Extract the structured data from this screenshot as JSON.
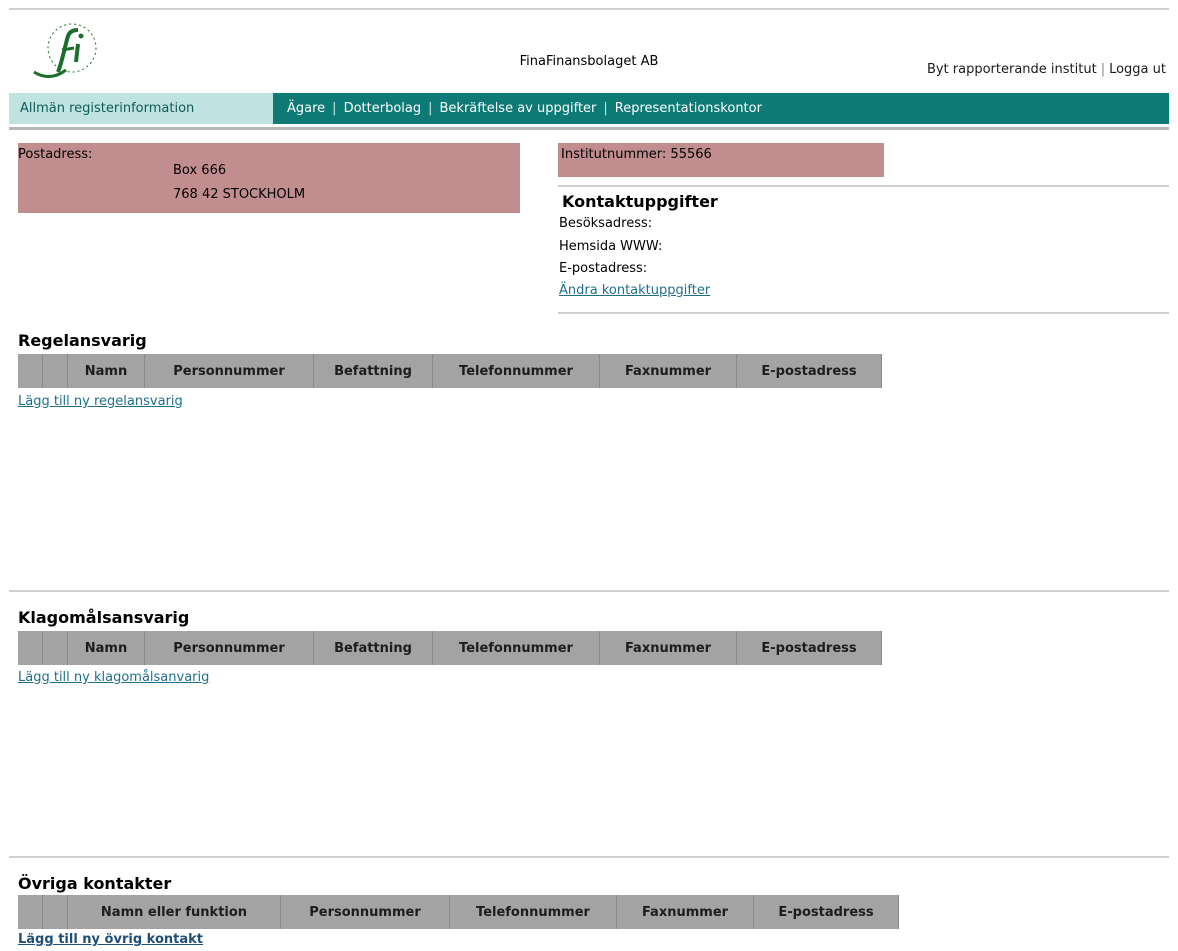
{
  "header": {
    "company_name": "FinaFinansbolaget AB",
    "change_institute_link": "Byt rapporterande institut",
    "separator": "|",
    "logout_link": "Logga ut"
  },
  "nav": {
    "active_tab": "Allmän registerinformation",
    "tabs": [
      "Ägare",
      "Dotterbolag",
      "Bekräftelse av uppgifter",
      "Representationskontor"
    ],
    "active_color": "#bfe3e1",
    "bar_color": "#0e7a76"
  },
  "postal": {
    "label": "Postadress:",
    "line1": "Box 666",
    "line2": "768 42 STOCKHOLM",
    "box_color": "#c28d8e"
  },
  "institute": {
    "label": "Institutnummer: 55566"
  },
  "contact": {
    "title": "Kontaktuppgifter",
    "visit_address_label": "Besöksadress:",
    "website_label": "Hemsida WWW:",
    "email_label": "E-postadress:",
    "edit_link": "Ändra kontaktuppgifter"
  },
  "sections": {
    "compliance": {
      "title": "Regelansvarig",
      "columns": [
        "Namn",
        "Personnummer",
        "Befattning",
        "Telefonnummer",
        "Faxnummer",
        "E-postadress"
      ],
      "add_link": "Lägg till ny regelansvarig"
    },
    "complaints": {
      "title": "Klagomålsansvarig",
      "columns": [
        "Namn",
        "Personnummer",
        "Befattning",
        "Telefonnummer",
        "Faxnummer",
        "E-postadress"
      ],
      "add_link": "Lägg till ny klagomålsanvarig"
    },
    "other": {
      "title": "Övriga kontakter",
      "columns": [
        "Namn eller funktion",
        "Personnummer",
        "Telefonnummer",
        "Faxnummer",
        "E-postadress"
      ],
      "add_link": "Lägg till ny övrig kontakt"
    }
  }
}
